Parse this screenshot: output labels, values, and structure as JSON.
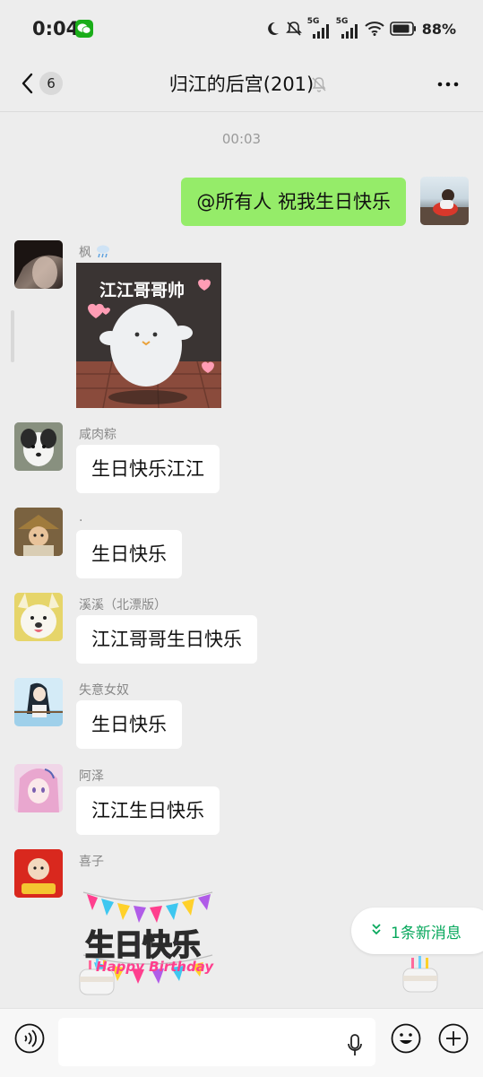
{
  "status_bar": {
    "time": "0:04",
    "signal_1": "5G",
    "signal_2": "5G",
    "battery": "88%"
  },
  "header": {
    "unread_count": "6",
    "title": "归江的后宫(201)"
  },
  "chat": {
    "timestamp": "00:03",
    "messages": [
      {
        "sender": "",
        "text": "@所有人  祝我生日快乐",
        "is_self": true
      },
      {
        "sender": "枫",
        "type": "sticker",
        "sticker_text": "江江哥哥帅"
      },
      {
        "sender": "咸肉粽",
        "text": "生日快乐江江"
      },
      {
        "sender": ".",
        "text": "生日快乐"
      },
      {
        "sender": "溪溪（北漂版）",
        "text": "江江哥哥生日快乐"
      },
      {
        "sender": "失意女奴",
        "text": "生日快乐"
      },
      {
        "sender": "阿泽",
        "text": "江江生日快乐"
      },
      {
        "sender": "喜子",
        "type": "sticker",
        "sticker_text_1": "生日快乐",
        "sticker_text_2": "Happy Birthday"
      }
    ]
  },
  "new_messages_button": {
    "label": "1条新消息"
  },
  "colors": {
    "self_bubble": "#95ec69",
    "accent_green": "#07a85c",
    "background": "#ededed"
  },
  "icons": [
    "wechat-icon",
    "back-icon",
    "mute-bell-icon",
    "more-icon",
    "voice-icon",
    "mic-icon",
    "emoji-icon",
    "plus-icon"
  ]
}
